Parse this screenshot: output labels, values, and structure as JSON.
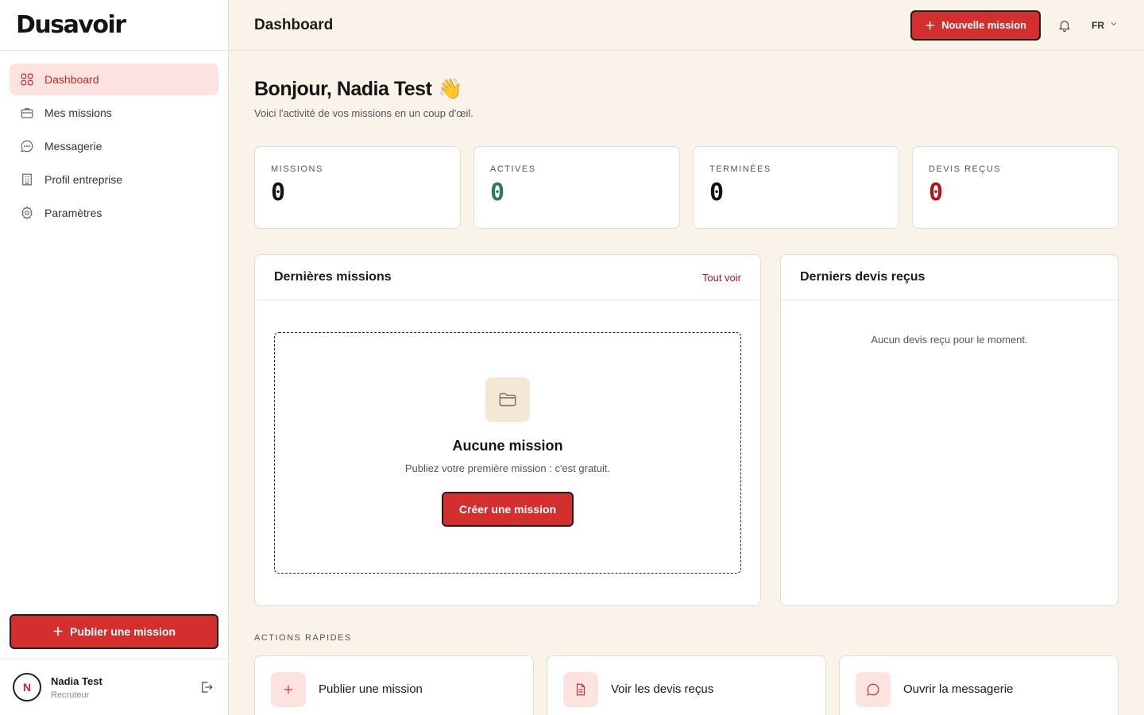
{
  "app": {
    "logo": "Dusavoir"
  },
  "sidebar": {
    "items": [
      {
        "label": "Dashboard",
        "icon": "grid-icon",
        "active": true
      },
      {
        "label": "Mes missions",
        "icon": "briefcase-icon"
      },
      {
        "label": "Messagerie",
        "icon": "chat-icon"
      },
      {
        "label": "Profil entreprise",
        "icon": "building-icon"
      },
      {
        "label": "Paramètres",
        "icon": "gear-icon"
      }
    ],
    "publish_label": "Publier une mission"
  },
  "user": {
    "initial": "N",
    "name": "Nadia Test",
    "role": "Recruteur"
  },
  "topbar": {
    "title": "Dashboard",
    "new_mission_label": "Nouvelle mission",
    "lang": "FR"
  },
  "main": {
    "greeting": "Bonjour, Nadia Test",
    "greeting_emoji": "👋",
    "subtitle": "Voici l'activité de vos missions en un coup d'œil.",
    "stats": [
      {
        "label": "MISSIONS",
        "value": "0"
      },
      {
        "label": "ACTIVES",
        "value": "0"
      },
      {
        "label": "TERMINÉES",
        "value": "0"
      },
      {
        "label": "DEVIS REÇUS",
        "value": "0"
      }
    ],
    "missions_panel": {
      "title": "Dernières missions",
      "link": "Tout voir",
      "empty_title": "Aucune mission",
      "empty_sub": "Publiez votre première mission : c'est gratuit.",
      "create_label": "Créer une mission"
    },
    "devis_panel": {
      "title": "Derniers devis reçus",
      "empty": "Aucun devis reçu pour le moment."
    },
    "quick_label": "ACTIONS RAPIDES",
    "quick_actions": [
      {
        "label": "Publier une mission",
        "icon": "plus-icon"
      },
      {
        "label": "Voir les devis reçus",
        "icon": "document-icon"
      },
      {
        "label": "Ouvrir la messagerie",
        "icon": "chat-icon"
      }
    ]
  },
  "colors": {
    "accent": "#d32f2f",
    "background": "#faf3ea",
    "active_green": "#2e7d4f",
    "devis_red": "#b3141b"
  }
}
